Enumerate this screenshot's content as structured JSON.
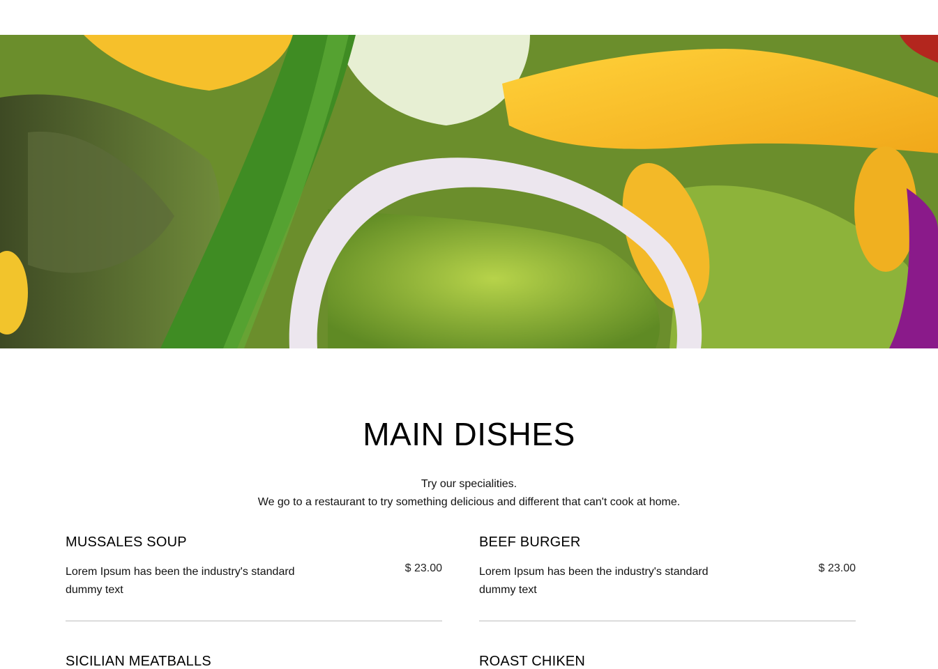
{
  "hero": {
    "image_alt": "salad-photo"
  },
  "section": {
    "title": "MAIN DISHES",
    "intro_line1": "Try our specialities.",
    "intro_line2": "We go to a restaurant to try something delicious and different that can't cook at home."
  },
  "menu": {
    "items": [
      {
        "name": "MUSSALES SOUP",
        "description": "Lorem Ipsum has been the industry's standard dummy text",
        "price": "$ 23.00"
      },
      {
        "name": "BEEF BURGER",
        "description": "Lorem Ipsum has been the industry's standard dummy text",
        "price": "$ 23.00"
      },
      {
        "name": "SICILIAN MEATBALLS"
      },
      {
        "name": "ROAST CHIKEN"
      }
    ]
  }
}
